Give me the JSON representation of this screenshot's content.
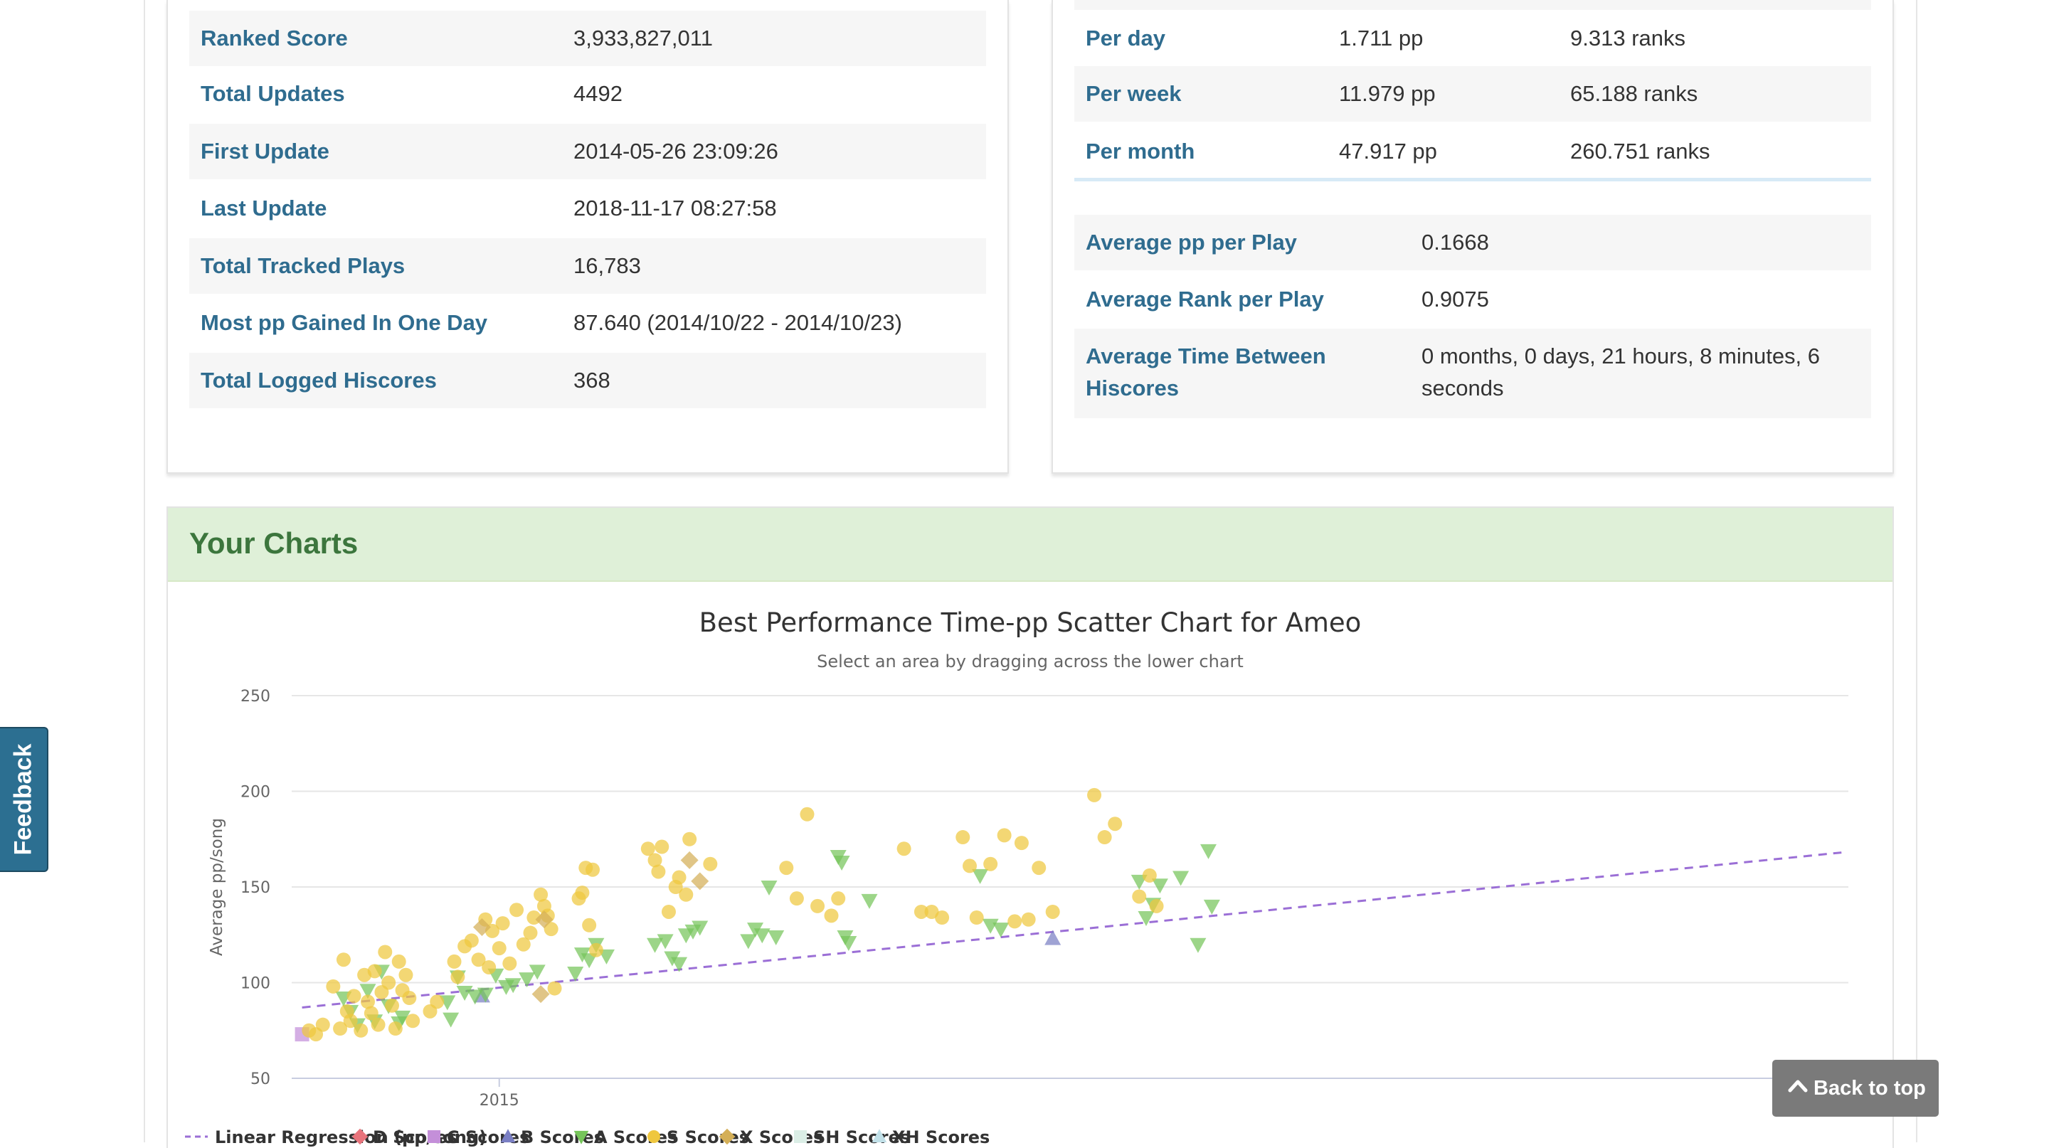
{
  "left_stats": [
    {
      "label": "Ranked Score",
      "value": "3,933,827,011"
    },
    {
      "label": "Total Updates",
      "value": "4492"
    },
    {
      "label": "First Update",
      "value": "2014-05-26 23:09:26"
    },
    {
      "label": "Last Update",
      "value": "2018-11-17 08:27:58"
    },
    {
      "label": "Total Tracked Plays",
      "value": "16,783"
    },
    {
      "label": "Most pp Gained In One Day",
      "value": "87.640 (2014/10/22 - 2014/10/23)"
    },
    {
      "label": "Total Logged Hiscores",
      "value": "368"
    }
  ],
  "rates": [
    {
      "label": "Per day",
      "pp": "1.711 pp",
      "ranks": "9.313 ranks"
    },
    {
      "label": "Per week",
      "pp": "11.979 pp",
      "ranks": "65.188 ranks"
    },
    {
      "label": "Per month",
      "pp": "47.917 pp",
      "ranks": "260.751 ranks"
    }
  ],
  "averages": [
    {
      "label": "Average pp per Play",
      "value": "0.1668"
    },
    {
      "label": "Average Rank per Play",
      "value": "0.9075"
    },
    {
      "label": "Average Time Between Hiscores",
      "value": "0 months, 0 days, 21 hours, 8 minutes, 6 seconds"
    }
  ],
  "charts_section": {
    "title": "Your Charts"
  },
  "chart_data": {
    "type": "scatter",
    "title": "Best Performance Time-pp Scatter Chart for Ameo",
    "subtitle": "Select an area by dragging across the lower chart",
    "ylabel": "Average pp/song",
    "xlabel": "",
    "ylim": [
      50,
      250
    ],
    "yticks": [
      50,
      100,
      150,
      200,
      250
    ],
    "xlim": [
      2014.4,
      2018.9
    ],
    "xticks": [
      {
        "value": 2015.0,
        "label": "2015"
      }
    ],
    "grid": true,
    "legend_position": "bottom",
    "regression": {
      "name": "Linear Regression (pp/song)",
      "from": [
        2014.43,
        87
      ],
      "to": [
        2018.88,
        168
      ],
      "color": "#9b6fd6"
    },
    "series": [
      {
        "name": "D Scores",
        "marker": "diamond",
        "color": "#e8747c",
        "points": []
      },
      {
        "name": "C Scores",
        "marker": "square",
        "color": "#c48fd9",
        "points": [
          [
            2014.43,
            73
          ]
        ]
      },
      {
        "name": "B Scores",
        "marker": "triangle",
        "color": "#7a7fc4",
        "points": [
          [
            2014.95,
            93
          ],
          [
            2016.6,
            123
          ]
        ]
      },
      {
        "name": "A Scores",
        "marker": "triangle-down",
        "color": "#76c55a",
        "points": [
          [
            2014.55,
            92
          ],
          [
            2014.57,
            85
          ],
          [
            2014.59,
            78
          ],
          [
            2014.62,
            96
          ],
          [
            2014.64,
            80
          ],
          [
            2014.66,
            106
          ],
          [
            2014.68,
            88
          ],
          [
            2014.71,
            79
          ],
          [
            2014.72,
            82
          ],
          [
            2014.85,
            90
          ],
          [
            2014.86,
            81
          ],
          [
            2014.88,
            103
          ],
          [
            2014.9,
            95
          ],
          [
            2014.93,
            93
          ],
          [
            2014.96,
            94
          ],
          [
            2014.99,
            104
          ],
          [
            2015.02,
            98
          ],
          [
            2015.04,
            99
          ],
          [
            2015.08,
            102
          ],
          [
            2015.11,
            106
          ],
          [
            2015.22,
            105
          ],
          [
            2015.24,
            115
          ],
          [
            2015.26,
            112
          ],
          [
            2015.28,
            120
          ],
          [
            2015.31,
            114
          ],
          [
            2015.45,
            120
          ],
          [
            2015.48,
            122
          ],
          [
            2015.5,
            113
          ],
          [
            2015.52,
            110
          ],
          [
            2015.54,
            125
          ],
          [
            2015.56,
            127
          ],
          [
            2015.58,
            129
          ],
          [
            2015.72,
            122
          ],
          [
            2015.74,
            128
          ],
          [
            2015.76,
            125
          ],
          [
            2015.78,
            150
          ],
          [
            2015.8,
            124
          ],
          [
            2015.98,
            166
          ],
          [
            2015.99,
            163
          ],
          [
            2016.0,
            124
          ],
          [
            2016.01,
            121
          ],
          [
            2016.07,
            143
          ],
          [
            2016.39,
            156
          ],
          [
            2016.42,
            130
          ],
          [
            2016.45,
            128
          ],
          [
            2016.85,
            153
          ],
          [
            2016.87,
            134
          ],
          [
            2016.89,
            141
          ],
          [
            2016.91,
            151
          ],
          [
            2016.97,
            155
          ],
          [
            2017.02,
            120
          ],
          [
            2017.05,
            169
          ],
          [
            2017.06,
            140
          ]
        ]
      },
      {
        "name": "S Scores",
        "marker": "circle",
        "color": "#efc73f",
        "points": [
          [
            2014.45,
            75
          ],
          [
            2014.47,
            73
          ],
          [
            2014.49,
            78
          ],
          [
            2014.52,
            98
          ],
          [
            2014.54,
            76
          ],
          [
            2014.55,
            112
          ],
          [
            2014.56,
            85
          ],
          [
            2014.57,
            80
          ],
          [
            2014.58,
            93
          ],
          [
            2014.6,
            75
          ],
          [
            2014.61,
            104
          ],
          [
            2014.62,
            90
          ],
          [
            2014.63,
            84
          ],
          [
            2014.64,
            106
          ],
          [
            2014.65,
            78
          ],
          [
            2014.66,
            95
          ],
          [
            2014.67,
            116
          ],
          [
            2014.68,
            100
          ],
          [
            2014.69,
            88
          ],
          [
            2014.7,
            76
          ],
          [
            2014.71,
            111
          ],
          [
            2014.72,
            96
          ],
          [
            2014.73,
            104
          ],
          [
            2014.74,
            92
          ],
          [
            2014.75,
            80
          ],
          [
            2014.8,
            85
          ],
          [
            2014.82,
            90
          ],
          [
            2014.87,
            111
          ],
          [
            2014.88,
            103
          ],
          [
            2014.9,
            119
          ],
          [
            2014.92,
            122
          ],
          [
            2014.94,
            112
          ],
          [
            2014.96,
            133
          ],
          [
            2014.97,
            108
          ],
          [
            2014.98,
            127
          ],
          [
            2015.0,
            118
          ],
          [
            2015.01,
            131
          ],
          [
            2015.03,
            110
          ],
          [
            2015.05,
            138
          ],
          [
            2015.07,
            120
          ],
          [
            2015.09,
            126
          ],
          [
            2015.1,
            134
          ],
          [
            2015.12,
            146
          ],
          [
            2015.13,
            140
          ],
          [
            2015.14,
            135
          ],
          [
            2015.15,
            128
          ],
          [
            2015.16,
            97
          ],
          [
            2015.23,
            144
          ],
          [
            2015.24,
            147
          ],
          [
            2015.25,
            160
          ],
          [
            2015.26,
            130
          ],
          [
            2015.27,
            159
          ],
          [
            2015.28,
            117
          ],
          [
            2015.43,
            170
          ],
          [
            2015.45,
            164
          ],
          [
            2015.46,
            158
          ],
          [
            2015.47,
            171
          ],
          [
            2015.49,
            137
          ],
          [
            2015.51,
            150
          ],
          [
            2015.52,
            155
          ],
          [
            2015.54,
            146
          ],
          [
            2015.55,
            175
          ],
          [
            2015.61,
            162
          ],
          [
            2015.83,
            160
          ],
          [
            2015.86,
            144
          ],
          [
            2015.89,
            188
          ],
          [
            2015.92,
            140
          ],
          [
            2015.96,
            135
          ],
          [
            2015.98,
            144
          ],
          [
            2016.17,
            170
          ],
          [
            2016.22,
            137
          ],
          [
            2016.25,
            137
          ],
          [
            2016.28,
            134
          ],
          [
            2016.34,
            176
          ],
          [
            2016.36,
            161
          ],
          [
            2016.38,
            134
          ],
          [
            2016.42,
            162
          ],
          [
            2016.46,
            177
          ],
          [
            2016.49,
            132
          ],
          [
            2016.51,
            173
          ],
          [
            2016.53,
            133
          ],
          [
            2016.56,
            160
          ],
          [
            2016.6,
            137
          ],
          [
            2016.72,
            198
          ],
          [
            2016.75,
            176
          ],
          [
            2016.78,
            183
          ],
          [
            2016.85,
            145
          ],
          [
            2016.88,
            156
          ],
          [
            2016.9,
            140
          ]
        ]
      },
      {
        "name": "X Scores",
        "marker": "diamond",
        "color": "#d4af57",
        "points": [
          [
            2014.95,
            129
          ],
          [
            2015.13,
            133
          ],
          [
            2015.12,
            94
          ],
          [
            2015.55,
            164
          ],
          [
            2015.58,
            153
          ]
        ]
      },
      {
        "name": "SH Scores",
        "marker": "square",
        "color": "#dbeee6",
        "points": []
      },
      {
        "name": "XH Scores",
        "marker": "triangle",
        "color": "#c1e0e8",
        "points": []
      }
    ]
  },
  "feedback": {
    "label": "Feedback"
  },
  "back_to_top": {
    "label": "Back to top",
    "icon": "chevron-up-icon"
  }
}
